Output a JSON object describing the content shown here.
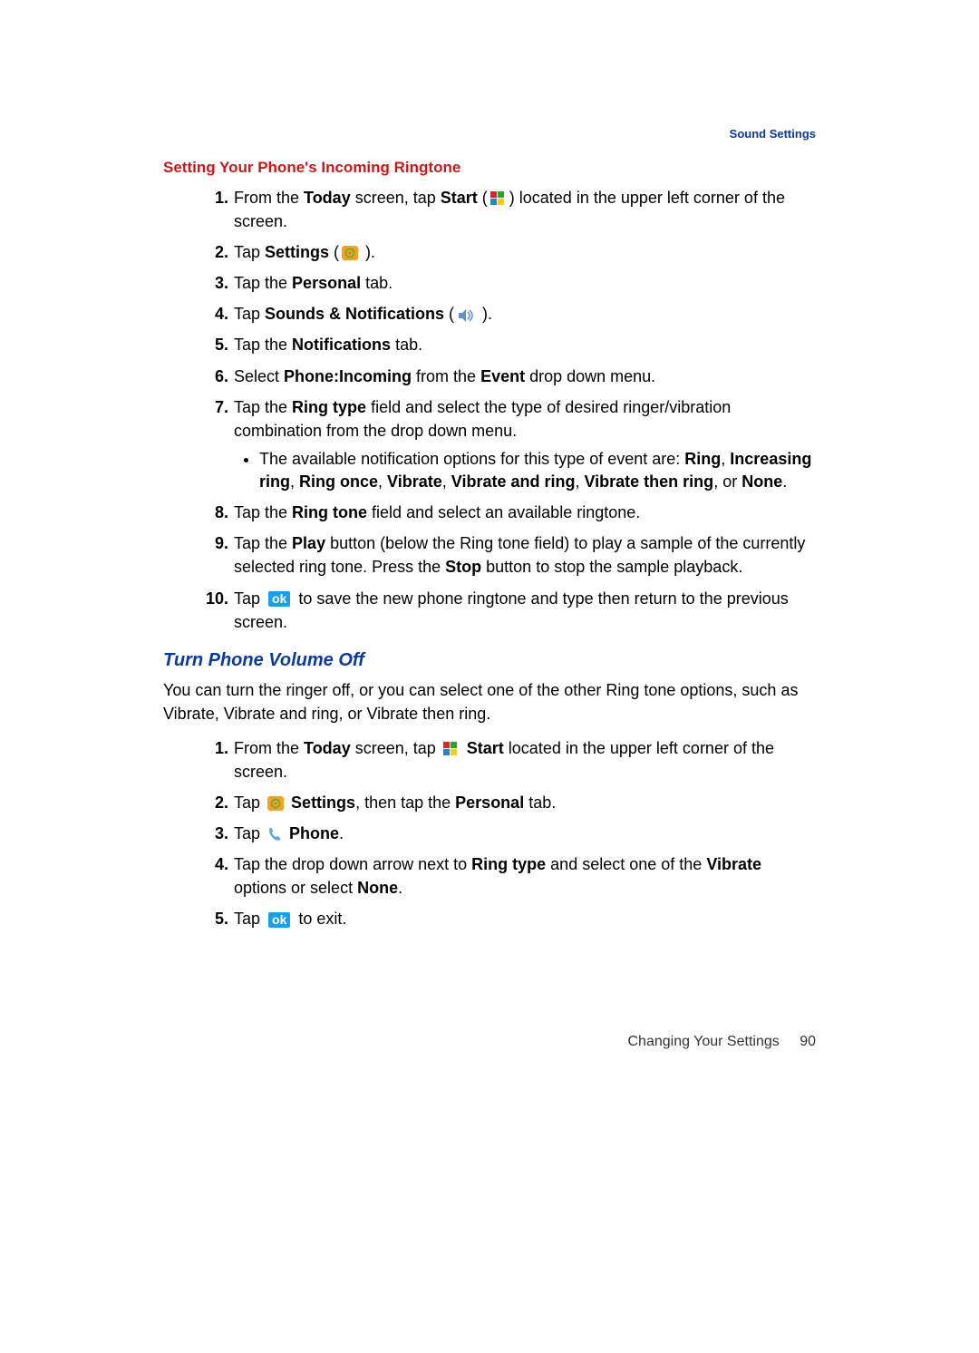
{
  "header": {
    "section": "Sound Settings"
  },
  "heading1": "Setting Your Phone's Incoming Ringtone",
  "steps1": {
    "s1": {
      "pre": "From the ",
      "today": "Today",
      "mid": " screen, tap ",
      "start": "Start",
      "post": " (",
      "after": ") located in the upper left corner of the screen."
    },
    "s2": {
      "pre": "Tap ",
      "settings": "Settings",
      "post": " (",
      "after": " )."
    },
    "s3": {
      "pre": "Tap the ",
      "personal": "Personal",
      "post": " tab."
    },
    "s4": {
      "pre": "Tap ",
      "sn": "Sounds & Notifications",
      "post": " (",
      "after": " )."
    },
    "s5": {
      "pre": "Tap the ",
      "notif": "Notifications",
      "post": " tab."
    },
    "s6": {
      "pre": "Select ",
      "pi": "Phone:Incoming",
      "mid": " from the ",
      "event": "Event",
      "post": " drop down menu."
    },
    "s7": {
      "pre": "Tap the ",
      "rt": "Ring type",
      "post": " field and select the type of desired ringer/vibration combination from the drop down menu."
    },
    "s7b": {
      "pre": "The available notification options for this type of event are: ",
      "o1": "Ring",
      "o2": "Increasing ring",
      "o3": "Ring once",
      "o4": "Vibrate",
      "o5": "Vibrate and ring",
      "o6": "Vibrate then ring",
      "o7": "None",
      "sep": ", ",
      "or": ", or ",
      "end": "."
    },
    "s8": {
      "pre": "Tap the ",
      "rtone": "Ring tone",
      "post": " field and select an available ringtone."
    },
    "s9": {
      "pre": "Tap the ",
      "play": "Play",
      "mid": " button (below the Ring tone field) to play a sample of the currently selected ring tone. Press the ",
      "stop": "Stop",
      "post": " button to stop the sample playback."
    },
    "s10": {
      "pre": "Tap ",
      "ok": "ok",
      "post": " to save the new phone ringtone and type then return to the previous screen."
    }
  },
  "heading2": "Turn Phone Volume Off",
  "para2": "You can turn the ringer off, or you can select one of the other Ring tone options, such as Vibrate, Vibrate and ring, or Vibrate then ring.",
  "steps2": {
    "s1": {
      "pre": "From the ",
      "today": "Today",
      "mid": " screen, tap ",
      "start": "Start",
      "post": " located in the upper left corner of the screen."
    },
    "s2": {
      "pre": "Tap ",
      "settings": "Settings",
      "mid": ", then tap the ",
      "personal": "Personal",
      "post": " tab."
    },
    "s3": {
      "pre": "Tap ",
      "phone": "Phone",
      "post": "."
    },
    "s4": {
      "pre": "Tap the drop down arrow next to ",
      "rt": "Ring type",
      "mid": " and select one of the ",
      "vib": "Vibrate",
      "mid2": " options or select ",
      "none": "None",
      "post": "."
    },
    "s5": {
      "pre": "Tap ",
      "ok": "ok",
      "post": " to exit."
    }
  },
  "footer": {
    "chapter": "Changing Your Settings",
    "page": "90"
  },
  "nums": {
    "n1": "1.",
    "n2": "2.",
    "n3": "3.",
    "n4": "4.",
    "n5": "5.",
    "n6": "6.",
    "n7": "7.",
    "n8": "8.",
    "n9": "9.",
    "n10": "10."
  }
}
